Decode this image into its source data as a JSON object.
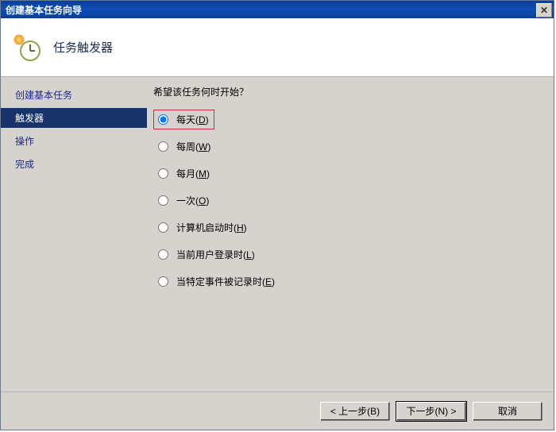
{
  "window": {
    "title": "创建基本任务向导"
  },
  "header": {
    "title": "任务触发器"
  },
  "sidebar": {
    "items": [
      {
        "label": "创建基本任务"
      },
      {
        "label": "触发器"
      },
      {
        "label": "操作"
      },
      {
        "label": "完成"
      }
    ],
    "active_index": 1
  },
  "content": {
    "question": "希望该任务何时开始？",
    "options": [
      {
        "label": "每天",
        "accel": "D",
        "checked": true,
        "highlight": true
      },
      {
        "label": "每周",
        "accel": "W",
        "checked": false,
        "highlight": false
      },
      {
        "label": "每月",
        "accel": "M",
        "checked": false,
        "highlight": false
      },
      {
        "label": "一次",
        "accel": "O",
        "checked": false,
        "highlight": false
      },
      {
        "label": "计算机启动时",
        "accel": "H",
        "checked": false,
        "highlight": false
      },
      {
        "label": "当前用户登录时",
        "accel": "L",
        "checked": false,
        "highlight": false
      },
      {
        "label": "当特定事件被记录时",
        "accel": "E",
        "checked": false,
        "highlight": false
      }
    ]
  },
  "footer": {
    "back": "< 上一步(B)",
    "next": "下一步(N) >",
    "cancel": "取消"
  }
}
